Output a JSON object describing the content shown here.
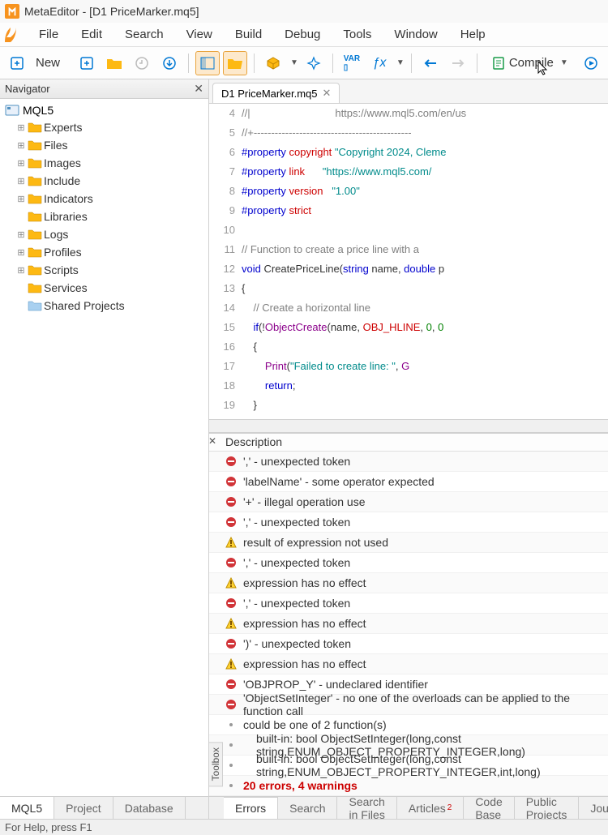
{
  "window": {
    "title": "MetaEditor - [D1 PriceMarker.mq5]"
  },
  "menus": [
    "File",
    "Edit",
    "Search",
    "View",
    "Build",
    "Debug",
    "Tools",
    "Window",
    "Help"
  ],
  "toolbar": {
    "new_label": "New",
    "compile_label": "Compile"
  },
  "navigator": {
    "title": "Navigator",
    "root": "MQL5",
    "items": [
      {
        "label": "Experts",
        "expandable": true
      },
      {
        "label": "Files",
        "expandable": true
      },
      {
        "label": "Images",
        "expandable": true
      },
      {
        "label": "Include",
        "expandable": true
      },
      {
        "label": "Indicators",
        "expandable": true
      },
      {
        "label": "Libraries",
        "expandable": false
      },
      {
        "label": "Logs",
        "expandable": true
      },
      {
        "label": "Profiles",
        "expandable": true
      },
      {
        "label": "Scripts",
        "expandable": true
      },
      {
        "label": "Services",
        "expandable": false
      },
      {
        "label": "Shared Projects",
        "expandable": false,
        "blue": true
      }
    ],
    "tabs": [
      "MQL5",
      "Project",
      "Database"
    ],
    "active_tab": 0
  },
  "editor": {
    "tab_name": "D1 PriceMarker.mq5",
    "lines": [
      {
        "n": 4,
        "html": "<span class='cmt'>//|                             https://www.mql5.com/en/us</span>"
      },
      {
        "n": 5,
        "html": "<span class='cmt'>//+---------------------------------------------</span>"
      },
      {
        "n": 6,
        "html": "<span class='kw-prop'>#property</span> <span class='kw-name'>copyright</span> <span class='str'>\"Copyright 2024, Cleme</span>"
      },
      {
        "n": 7,
        "html": "<span class='kw-prop'>#property</span> <span class='kw-name'>link</span>      <span class='str'>\"https://www.mql5.com/</span>"
      },
      {
        "n": 8,
        "html": "<span class='kw-prop'>#property</span> <span class='kw-name'>version</span>   <span class='str'>\"1.00\"</span>"
      },
      {
        "n": 9,
        "html": "<span class='kw-prop'>#property</span> <span class='kw-name'>strict</span>"
      },
      {
        "n": 10,
        "html": ""
      },
      {
        "n": 11,
        "html": "<span class='cmt'>// Function to create a price line with a </span>"
      },
      {
        "n": 12,
        "html": "<span class='kw-type'>void</span> CreatePriceLine(<span class='kw-type'>string</span> name, <span class='kw-type'>double</span> p"
      },
      {
        "n": 13,
        "html": "{"
      },
      {
        "n": 14,
        "html": "    <span class='cmt'>// Create a horizontal line</span>"
      },
      {
        "n": 15,
        "html": "    <span class='kw-type'>if</span>(!<span class='func'>ObjectCreate</span>(name, <span class='kw-name'>OBJ_HLINE</span>, <span class='num'>0</span>, <span class='num'>0</span>"
      },
      {
        "n": 16,
        "html": "    {"
      },
      {
        "n": 17,
        "html": "        <span class='func'>Print</span>(<span class='str'>\"Failed to create line: \"</span>, <span class='func'>G</span>"
      },
      {
        "n": 18,
        "html": "        <span class='kw-type'>return</span>;"
      },
      {
        "n": 19,
        "html": "    }"
      }
    ]
  },
  "toolbox": {
    "header": "Description",
    "label": "Toolbox",
    "rows": [
      {
        "type": "error",
        "msg": "',' - unexpected token"
      },
      {
        "type": "error",
        "msg": "'labelName' - some operator expected"
      },
      {
        "type": "error",
        "msg": "'+' - illegal operation use"
      },
      {
        "type": "error",
        "msg": "',' - unexpected token"
      },
      {
        "type": "warning",
        "msg": "result of expression not used"
      },
      {
        "type": "error",
        "msg": "',' - unexpected token"
      },
      {
        "type": "warning",
        "msg": "expression has no effect"
      },
      {
        "type": "error",
        "msg": "',' - unexpected token"
      },
      {
        "type": "warning",
        "msg": "expression has no effect"
      },
      {
        "type": "error",
        "msg": "')' - unexpected token"
      },
      {
        "type": "warning",
        "msg": "expression has no effect"
      },
      {
        "type": "error",
        "msg": "'OBJPROP_Y' - undeclared identifier"
      },
      {
        "type": "error",
        "msg": "'ObjectSetInteger' - no one of the overloads can be applied to the function call"
      },
      {
        "type": "info",
        "msg": "could be one of 2 function(s)"
      },
      {
        "type": "info",
        "msg": "built-in: bool ObjectSetInteger(long,const string,ENUM_OBJECT_PROPERTY_INTEGER,long)",
        "indent": true
      },
      {
        "type": "info",
        "msg": "built-in: bool ObjectSetInteger(long,const string,ENUM_OBJECT_PROPERTY_INTEGER,int,long)",
        "indent": true
      },
      {
        "type": "summary",
        "msg": "20 errors, 4 warnings"
      }
    ],
    "tabs": [
      {
        "label": "Errors"
      },
      {
        "label": "Search"
      },
      {
        "label": "Search in Files"
      },
      {
        "label": "Articles",
        "badge": "2"
      },
      {
        "label": "Code Base"
      },
      {
        "label": "Public Projects"
      },
      {
        "label": "Journal"
      }
    ],
    "active_tab": 0
  },
  "statusbar": {
    "text": "For Help, press F1"
  }
}
